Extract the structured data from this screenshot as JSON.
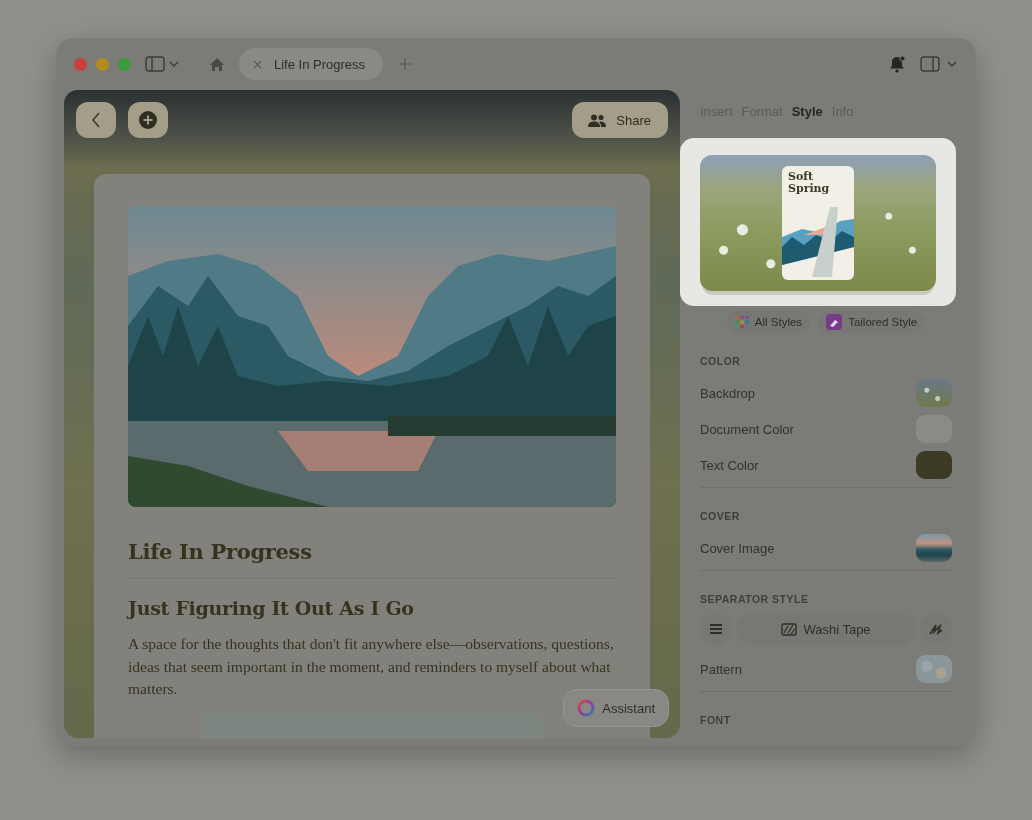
{
  "window": {
    "tab": {
      "title": "Life In Progress",
      "selected": true
    }
  },
  "document": {
    "share_button": "Share",
    "title": "Life In Progress",
    "subtitle": "Just Figuring It Out As I Go",
    "body": "A space for the thoughts that don't fit anywhere else—observations, questions, ideas that seem important in the moment, and reminders to myself about what matters.",
    "assistant_button": "Assistant"
  },
  "inspector": {
    "tabs": [
      {
        "label": "Insert",
        "selected": false
      },
      {
        "label": "Format",
        "selected": false
      },
      {
        "label": "Style",
        "selected": true
      },
      {
        "label": "Info",
        "selected": false
      }
    ],
    "preview": {
      "title": "Soft Spring"
    },
    "style_buttons": [
      {
        "label": "All Styles",
        "kind": "grid"
      },
      {
        "label": "Tailored Style",
        "kind": "brush"
      }
    ],
    "sections": [
      {
        "header": "COLOR",
        "rows": [
          {
            "label": "Backdrop",
            "kind": "meadow"
          },
          {
            "label": "Document Color",
            "kind": "color",
            "color": "#8a8a86"
          },
          {
            "label": "Text Color",
            "kind": "color",
            "color": "#3c3a24"
          }
        ]
      },
      {
        "header": "COVER",
        "rows": [
          {
            "label": "Cover Image",
            "kind": "landscape"
          }
        ]
      },
      {
        "header": "SEPARATOR STYLE",
        "separator": {
          "label": "Washi Tape"
        },
        "rows": [
          {
            "label": "Pattern",
            "kind": "pattern"
          }
        ]
      },
      {
        "header": "FONT"
      }
    ]
  }
}
